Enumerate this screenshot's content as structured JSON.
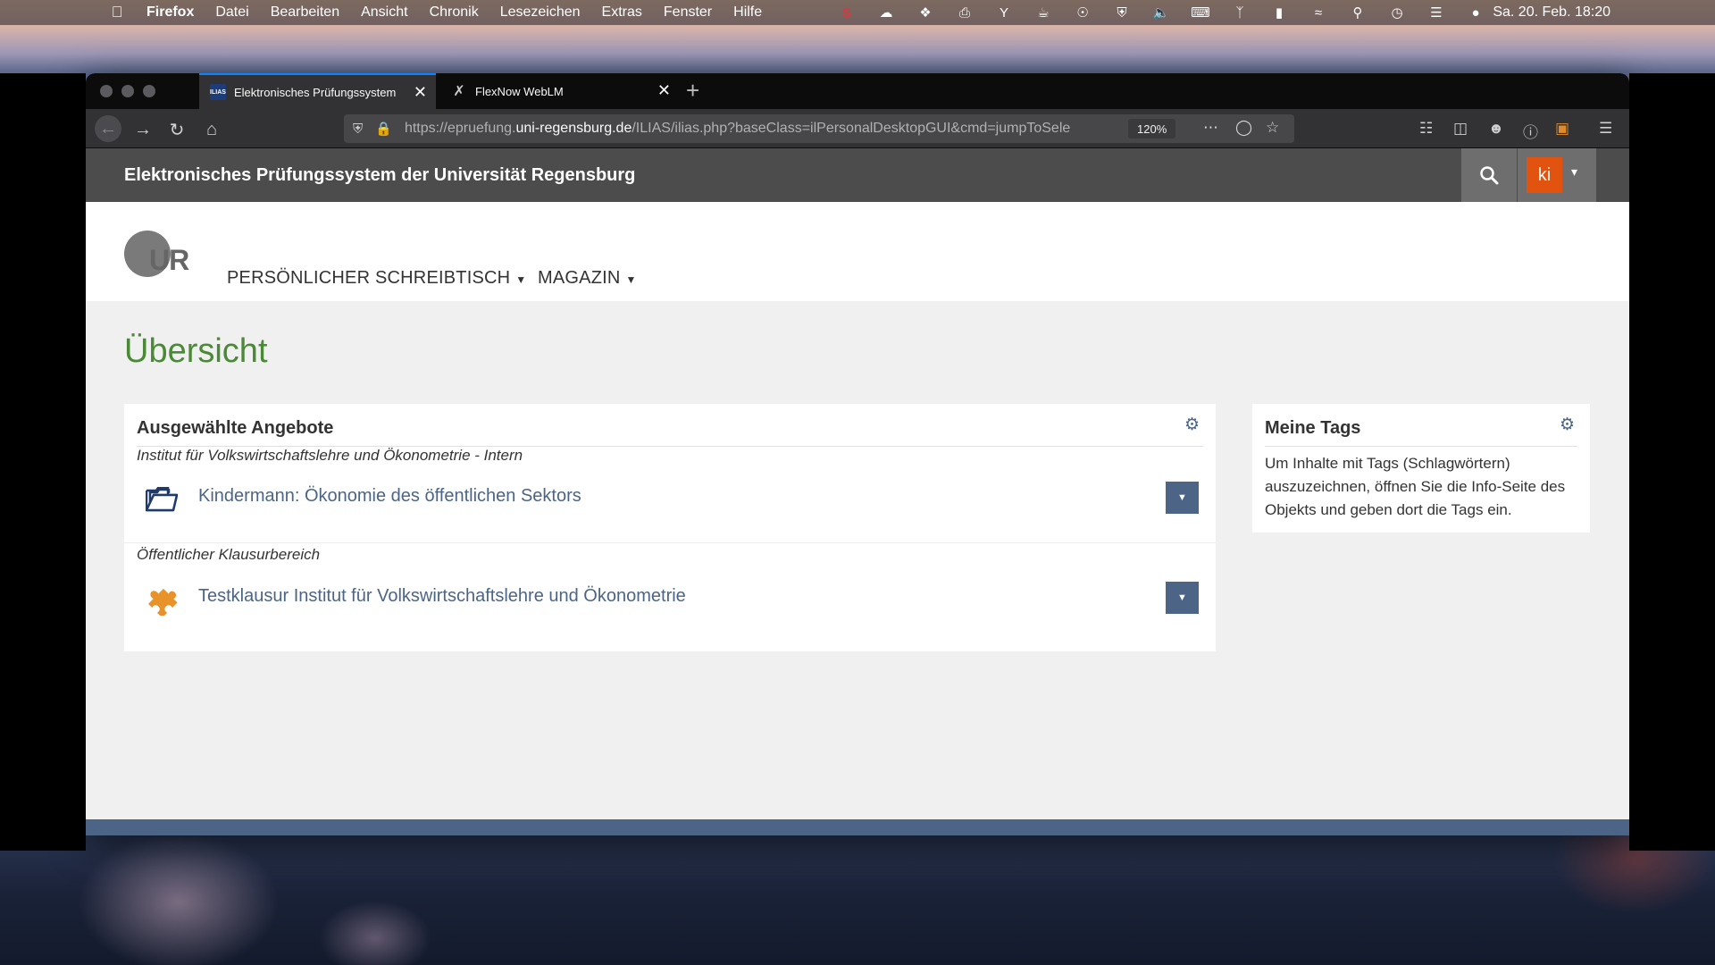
{
  "menubar": {
    "app": "Firefox",
    "items": [
      "Datei",
      "Bearbeiten",
      "Ansicht",
      "Chronik",
      "Lesezeichen",
      "Extras",
      "Fenster",
      "Hilfe"
    ],
    "clock": "Sa. 20. Feb.  18:20"
  },
  "browser": {
    "tabs": [
      {
        "title": "Elektronisches Prüfungssystem",
        "favicon": "ILIAS",
        "active": true
      },
      {
        "title": "FlexNow WebLM",
        "favicon": "FN",
        "active": false
      }
    ],
    "url_prefix": "https://epruefung.",
    "url_domain": "uni-regensburg.de",
    "url_path": "/ILIAS/ilias.php?baseClass=ilPersonalDesktopGUI&cmd=jumpToSele",
    "zoom": "120%"
  },
  "site": {
    "title": "Elektronisches Prüfungssystem der Universität Regensburg",
    "avatar_initials": "ki",
    "logo_text": "UR",
    "nav": [
      "PERSÖNLICHER SCHREIBTISCH",
      "MAGAZIN"
    ],
    "page_title": "Übersicht"
  },
  "offers_panel": {
    "heading": "Ausgewählte Angebote",
    "groups": [
      {
        "label": "Institut für Volkswirtschaftslehre und Ökonometrie - Intern",
        "item": "Kindermann: Ökonomie des öffentlichen Sektors",
        "icon": "folder-icon"
      },
      {
        "label": "Öffentlicher Klausurbereich",
        "item": "Testklausur Institut für Volkswirtschaftslehre und Ökonometrie",
        "icon": "puzzle-icon"
      }
    ]
  },
  "tags_panel": {
    "heading": "Meine Tags",
    "text": "Um Inhalte mit Tags (Schlagwörtern) auszuzeichnen, öffnen Sie die Info-Seite des Objekts und geben dort die Tags ein."
  },
  "colors": {
    "accent": "#4c6586",
    "title_green": "#4a8a36",
    "avatar_orange": "#e2530f",
    "topbar": "#4c4c4c"
  }
}
